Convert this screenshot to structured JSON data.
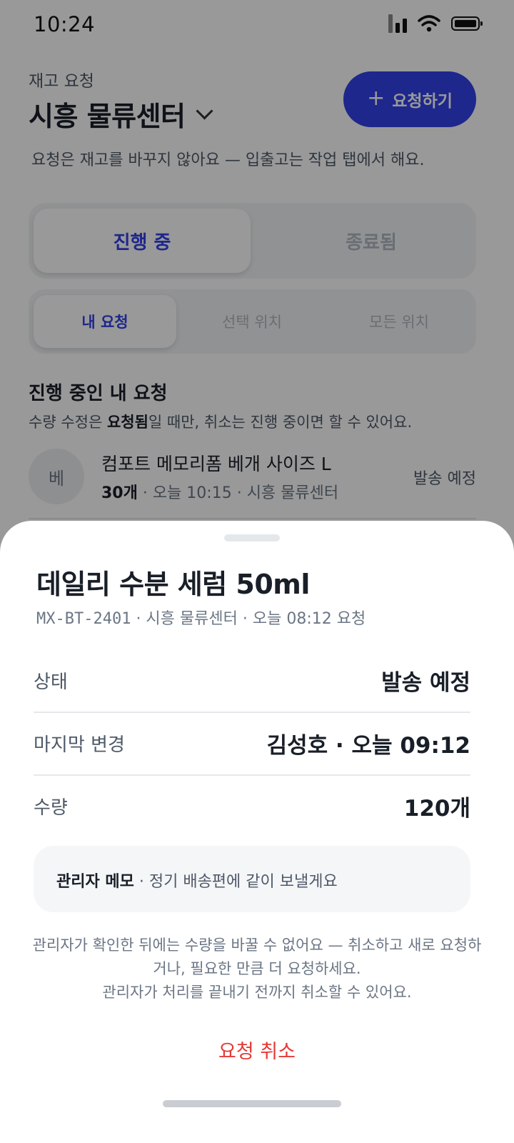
{
  "status_bar": {
    "time": "10:24",
    "icons": [
      "signal-icon",
      "wifi-icon",
      "battery-icon"
    ]
  },
  "header": {
    "kicker": "재고 요청",
    "center": "시흥 물류센터",
    "request_button": "요청하기",
    "subtitle": "요청은 재고를 바꾸지 않아요 — 입출고는 작업 탭에서 해요."
  },
  "tabs": {
    "status": [
      "진행 중",
      "종료됨"
    ],
    "status_selected": "진행 중",
    "scope": [
      "내 요청",
      "선택 위치",
      "모든 위치"
    ],
    "scope_selected": "내 요청"
  },
  "section": {
    "title": "진행 중인 내 요청",
    "desc_prefix": "수량 수정은 ",
    "desc_bold": "요청됨",
    "desc_suffix": "일 때만, 취소는 진행 중이면 할 수 있어요."
  },
  "list": [
    {
      "avatar": "베",
      "name": "컴포트 메모리폼 베개 사이즈 L",
      "qty": "30개",
      "meta": " · 오늘 10:15 · 시흥 물류센터",
      "status": "발송 예정"
    }
  ],
  "sheet": {
    "title": "데일리 수분 세럼 50ml",
    "code": "MX-BT-2401",
    "sub_rest": " · 시흥 물류센터 · 오늘 08:12 요청",
    "rows": [
      {
        "label": "상태",
        "value": "발송 예정"
      },
      {
        "label": "마지막 변경",
        "value": "김성호 · 오늘 09:12"
      },
      {
        "label": "수량",
        "value": "120개"
      }
    ],
    "memo_label": "관리자 메모",
    "memo_text": " · 정기 배송편에 같이 보낼게요",
    "note_1": "관리자가 확인한 뒤에는 수량을 바꿀 수 없어요 — 취소하고 새로 요청하거나, 필요한 만큼 더 요청하세요.",
    "note_2": "관리자가 처리를 끝내기 전까지 취소할 수 있어요.",
    "cancel": "요청 취소"
  }
}
